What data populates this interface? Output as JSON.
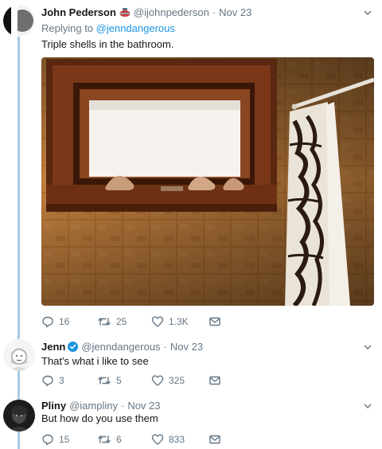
{
  "tweets": [
    {
      "name": "John Pederson",
      "handle": "@ijohnpederson",
      "date": "Nov 23",
      "reply_prefix": "Replying to ",
      "reply_handle": "@jenndangerous",
      "text": "Triple shells in the bathroom.",
      "replies": "16",
      "retweets": "25",
      "likes": "1.3K"
    },
    {
      "name": "Jenn",
      "handle": "@jenndangerous",
      "date": "Nov 23",
      "text": "That's what i like to see",
      "replies": "3",
      "retweets": "5",
      "likes": "325"
    },
    {
      "name": "Pliny",
      "handle": "@iampliny",
      "date": "Nov 23",
      "text": "But how do you use them",
      "replies": "15",
      "retweets": "6",
      "likes": "833"
    }
  ],
  "colors": {
    "accent": "#1b95e0",
    "muted": "#657786",
    "thread_line": "#a9cbe2"
  }
}
